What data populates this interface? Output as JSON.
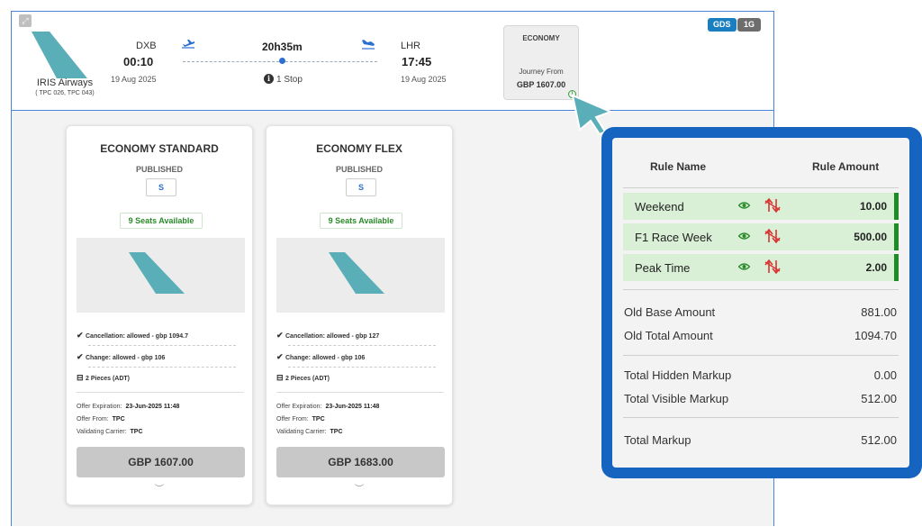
{
  "badges": {
    "gds": "GDS",
    "provider": "1G"
  },
  "flight": {
    "airline_name": "IRIS Airways",
    "airline_codes": "( TPC 026, TPC 043)",
    "departure": {
      "code": "DXB",
      "time": "00:10",
      "date": "19 Aug 2025"
    },
    "arrival": {
      "code": "LHR",
      "time": "17:45",
      "date": "19 Aug 2025"
    },
    "duration": "20h35m",
    "stops": "1 Stop",
    "info_glyph": "i"
  },
  "fare_summary": {
    "cabin": "ECONOMY",
    "from_label": "Journey From",
    "price": "GBP 1607.00"
  },
  "cards": [
    {
      "title": "ECONOMY STANDARD",
      "fare_type": "PUBLISHED",
      "booking_code": "S",
      "seats": "9 Seats Available",
      "features": [
        "Cancellation: allowed - gbp 1094.7",
        "Change: allowed - gbp 106",
        "2 Pieces (ADT)"
      ],
      "meta": {
        "expiration_label": "Offer Expiration:",
        "expiration": "23-Jun-2025 11:48",
        "offer_from_label": "Offer From:",
        "offer_from": "TPC",
        "carrier_label": "Validating Carrier:",
        "carrier": "TPC"
      },
      "price": "GBP 1607.00"
    },
    {
      "title": "ECONOMY FLEX",
      "fare_type": "PUBLISHED",
      "booking_code": "S",
      "seats": "9 Seats Available",
      "features": [
        "Cancellation: allowed - gbp 127",
        "Change: allowed - gbp 106",
        "2 Pieces (ADT)"
      ],
      "meta": {
        "expiration_label": "Offer Expiration:",
        "expiration": "23-Jun-2025 11:48",
        "offer_from_label": "Offer From:",
        "offer_from": "TPC",
        "carrier_label": "Validating Carrier:",
        "carrier": "TPC"
      },
      "price": "GBP 1683.00"
    }
  ],
  "markup_panel": {
    "headers": {
      "name": "Rule Name",
      "amount": "Rule Amount"
    },
    "rules": [
      {
        "name": "Weekend",
        "amount": "10.00"
      },
      {
        "name": "F1 Race Week",
        "amount": "500.00"
      },
      {
        "name": "Peak Time",
        "amount": "2.00"
      }
    ],
    "summary": [
      {
        "label": "Old Base Amount",
        "value": "881.00"
      },
      {
        "label": "Old Total Amount",
        "value": "1094.70"
      },
      {
        "label": "Total Hidden Markup",
        "value": "0.00"
      },
      {
        "label": "Total Visible Markup",
        "value": "512.00"
      },
      {
        "label": "Total Markup",
        "value": "512.00"
      }
    ]
  },
  "colors": {
    "accent_blue": "#1565c0",
    "rule_green": "#1e8c26",
    "rule_bg": "#d9f0d6",
    "tail_teal": "#5aaeb8"
  }
}
